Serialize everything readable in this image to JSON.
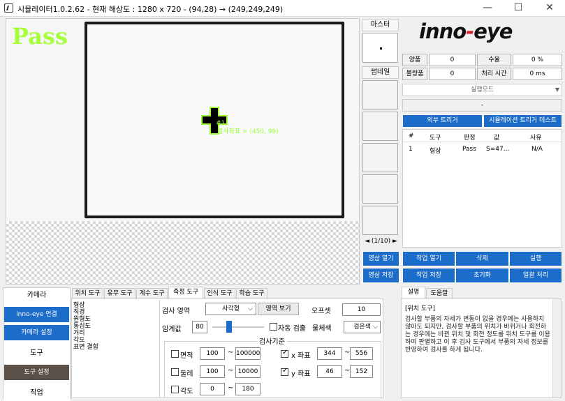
{
  "window": {
    "title": "시뮬레이터1.0.2.62 - 현재 해상도 : 1280 x 720 - (94,28) → (249,249,249)"
  },
  "viewer": {
    "result": "Pass",
    "target_number": "#1",
    "coord_label": "검사좌표 = (450, 99)"
  },
  "side": {
    "master": "마스터",
    "thumbnail": "썸네일",
    "pager": "◄ (1/10) ►"
  },
  "logo": {
    "part1": "inno",
    "dash": "-",
    "part2": "eye"
  },
  "stats": {
    "good_label": "양품",
    "good": "0",
    "yield_label": "수율",
    "yield": "0 %",
    "bad_label": "불량품",
    "bad": "0",
    "time_label": "처리 시간",
    "time": "0 ms"
  },
  "mode": {
    "select": "실행모드",
    "status": "-"
  },
  "triggers": {
    "external": "외부 트리거",
    "sim_test": "시뮬레이션 트리거 테스트"
  },
  "table": {
    "headers": [
      "#",
      "도구",
      "판정",
      "값",
      "사유"
    ],
    "rows": [
      [
        "1",
        "형상",
        "Pass",
        "S=47...",
        "N/A"
      ]
    ]
  },
  "actions": {
    "open_image": "영상 열기",
    "open_job": "작업 열기",
    "delete": "삭제",
    "run": "실행",
    "save_image": "영상 저장",
    "save_job": "작업 저장",
    "reset": "초기화",
    "batch": "일괄 처리"
  },
  "left_panel": {
    "camera": "카메라",
    "connect": "inno-eye 연결",
    "cam_settings": "카메라 설정",
    "tool": "도구",
    "tool_settings": "도구 설정",
    "job": "작업"
  },
  "tabs": [
    "위치 도구",
    "유무 도구",
    "계수 도구",
    "측정 도구",
    "인식 도구",
    "학습 도구"
  ],
  "tool_list": [
    "형상",
    "직경",
    "원형도",
    "동심도",
    "거리",
    "각도",
    "표면 결함"
  ],
  "tool_form": {
    "area_label": "검사 영역",
    "area_value": "사각형",
    "view_area": "영역 보기",
    "offset_label": "오프셋",
    "offset": "10",
    "threshold_label": "임계값",
    "threshold": "80",
    "threshold_level": 0.31,
    "auto_detect": "자동 검출",
    "object_color_label": "물체색",
    "object_color": "검은색",
    "criteria": "검사기준",
    "area_cb": "면적",
    "area_min": "100",
    "area_max": "100000",
    "ratio_cb": "둘레",
    "ratio_min": "100",
    "ratio_max": "10000",
    "angle_cb": "각도",
    "angle_min": "0",
    "angle_max": "180",
    "x_cb": "x 좌표",
    "x_min": "344",
    "x_max": "556",
    "y_cb": "y 좌표",
    "y_min": "46",
    "y_max": "152",
    "tilde": "~"
  },
  "help": {
    "tab_desc": "설명",
    "tab_help": "도움말",
    "title": "[위치 도구]",
    "text": "검사할 부품의 자세가 변동이 없을 경우에는 사용하지 않아도 되지만, 검사할 부품의 위치가 바뀌거나 회전하는 경우에는 바뀐 위치 및 회전 정도를 위치 도구를 이용하여 판별하고 이 후 검사 도구에서 부품의 자세 정보를 반영하여 검사를 하게 됩니다."
  },
  "colors": {
    "blue": "#1c6dc9",
    "pass": "#a6ff3a",
    "dark_btn": "#5a5048"
  }
}
